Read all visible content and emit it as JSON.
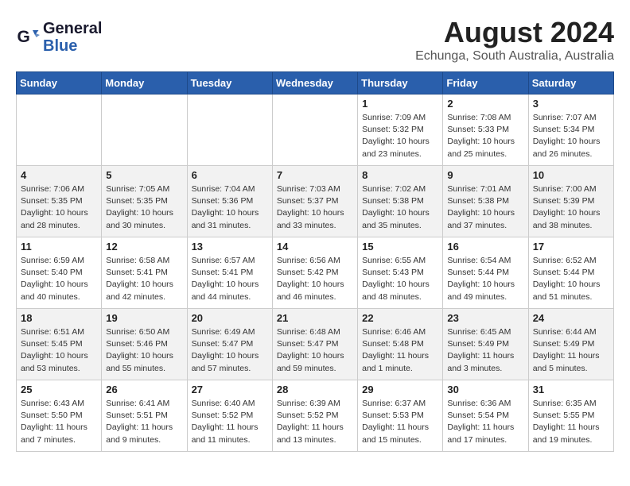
{
  "header": {
    "logo_line1": "General",
    "logo_line2": "Blue",
    "title": "August 2024",
    "subtitle": "Echunga, South Australia, Australia"
  },
  "weekdays": [
    "Sunday",
    "Monday",
    "Tuesday",
    "Wednesday",
    "Thursday",
    "Friday",
    "Saturday"
  ],
  "weeks": [
    [
      {
        "day": "",
        "info": ""
      },
      {
        "day": "",
        "info": ""
      },
      {
        "day": "",
        "info": ""
      },
      {
        "day": "",
        "info": ""
      },
      {
        "day": "1",
        "info": "Sunrise: 7:09 AM\nSunset: 5:32 PM\nDaylight: 10 hours\nand 23 minutes."
      },
      {
        "day": "2",
        "info": "Sunrise: 7:08 AM\nSunset: 5:33 PM\nDaylight: 10 hours\nand 25 minutes."
      },
      {
        "day": "3",
        "info": "Sunrise: 7:07 AM\nSunset: 5:34 PM\nDaylight: 10 hours\nand 26 minutes."
      }
    ],
    [
      {
        "day": "4",
        "info": "Sunrise: 7:06 AM\nSunset: 5:35 PM\nDaylight: 10 hours\nand 28 minutes."
      },
      {
        "day": "5",
        "info": "Sunrise: 7:05 AM\nSunset: 5:35 PM\nDaylight: 10 hours\nand 30 minutes."
      },
      {
        "day": "6",
        "info": "Sunrise: 7:04 AM\nSunset: 5:36 PM\nDaylight: 10 hours\nand 31 minutes."
      },
      {
        "day": "7",
        "info": "Sunrise: 7:03 AM\nSunset: 5:37 PM\nDaylight: 10 hours\nand 33 minutes."
      },
      {
        "day": "8",
        "info": "Sunrise: 7:02 AM\nSunset: 5:38 PM\nDaylight: 10 hours\nand 35 minutes."
      },
      {
        "day": "9",
        "info": "Sunrise: 7:01 AM\nSunset: 5:38 PM\nDaylight: 10 hours\nand 37 minutes."
      },
      {
        "day": "10",
        "info": "Sunrise: 7:00 AM\nSunset: 5:39 PM\nDaylight: 10 hours\nand 38 minutes."
      }
    ],
    [
      {
        "day": "11",
        "info": "Sunrise: 6:59 AM\nSunset: 5:40 PM\nDaylight: 10 hours\nand 40 minutes."
      },
      {
        "day": "12",
        "info": "Sunrise: 6:58 AM\nSunset: 5:41 PM\nDaylight: 10 hours\nand 42 minutes."
      },
      {
        "day": "13",
        "info": "Sunrise: 6:57 AM\nSunset: 5:41 PM\nDaylight: 10 hours\nand 44 minutes."
      },
      {
        "day": "14",
        "info": "Sunrise: 6:56 AM\nSunset: 5:42 PM\nDaylight: 10 hours\nand 46 minutes."
      },
      {
        "day": "15",
        "info": "Sunrise: 6:55 AM\nSunset: 5:43 PM\nDaylight: 10 hours\nand 48 minutes."
      },
      {
        "day": "16",
        "info": "Sunrise: 6:54 AM\nSunset: 5:44 PM\nDaylight: 10 hours\nand 49 minutes."
      },
      {
        "day": "17",
        "info": "Sunrise: 6:52 AM\nSunset: 5:44 PM\nDaylight: 10 hours\nand 51 minutes."
      }
    ],
    [
      {
        "day": "18",
        "info": "Sunrise: 6:51 AM\nSunset: 5:45 PM\nDaylight: 10 hours\nand 53 minutes."
      },
      {
        "day": "19",
        "info": "Sunrise: 6:50 AM\nSunset: 5:46 PM\nDaylight: 10 hours\nand 55 minutes."
      },
      {
        "day": "20",
        "info": "Sunrise: 6:49 AM\nSunset: 5:47 PM\nDaylight: 10 hours\nand 57 minutes."
      },
      {
        "day": "21",
        "info": "Sunrise: 6:48 AM\nSunset: 5:47 PM\nDaylight: 10 hours\nand 59 minutes."
      },
      {
        "day": "22",
        "info": "Sunrise: 6:46 AM\nSunset: 5:48 PM\nDaylight: 11 hours\nand 1 minute."
      },
      {
        "day": "23",
        "info": "Sunrise: 6:45 AM\nSunset: 5:49 PM\nDaylight: 11 hours\nand 3 minutes."
      },
      {
        "day": "24",
        "info": "Sunrise: 6:44 AM\nSunset: 5:49 PM\nDaylight: 11 hours\nand 5 minutes."
      }
    ],
    [
      {
        "day": "25",
        "info": "Sunrise: 6:43 AM\nSunset: 5:50 PM\nDaylight: 11 hours\nand 7 minutes."
      },
      {
        "day": "26",
        "info": "Sunrise: 6:41 AM\nSunset: 5:51 PM\nDaylight: 11 hours\nand 9 minutes."
      },
      {
        "day": "27",
        "info": "Sunrise: 6:40 AM\nSunset: 5:52 PM\nDaylight: 11 hours\nand 11 minutes."
      },
      {
        "day": "28",
        "info": "Sunrise: 6:39 AM\nSunset: 5:52 PM\nDaylight: 11 hours\nand 13 minutes."
      },
      {
        "day": "29",
        "info": "Sunrise: 6:37 AM\nSunset: 5:53 PM\nDaylight: 11 hours\nand 15 minutes."
      },
      {
        "day": "30",
        "info": "Sunrise: 6:36 AM\nSunset: 5:54 PM\nDaylight: 11 hours\nand 17 minutes."
      },
      {
        "day": "31",
        "info": "Sunrise: 6:35 AM\nSunset: 5:55 PM\nDaylight: 11 hours\nand 19 minutes."
      }
    ]
  ]
}
